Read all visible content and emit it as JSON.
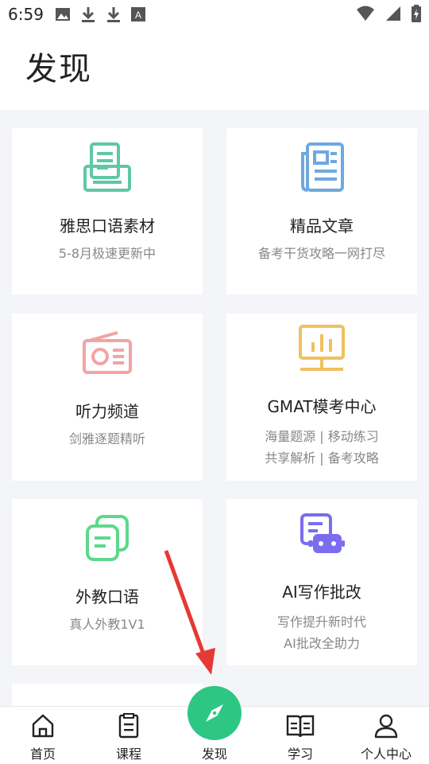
{
  "status_bar": {
    "time": "6:59",
    "left_icons": [
      "image-icon",
      "download-icon",
      "download-icon",
      "font-icon"
    ],
    "right_icons": [
      "wifi-icon",
      "signal-icon",
      "battery-charging-icon"
    ]
  },
  "header": {
    "title": "发现"
  },
  "cards": [
    {
      "title": "雅思口语素材",
      "subtitle_lines": [
        "5-8月极速更新中"
      ],
      "icon": "document-tray-icon",
      "color": "#5ec8a3"
    },
    {
      "title": "精品文章",
      "subtitle_lines": [
        "备考干货攻略一网打尽"
      ],
      "icon": "newspaper-icon",
      "color": "#6fa8e0"
    },
    {
      "title": "听力频道",
      "subtitle_lines": [
        "剑雅逐题精听"
      ],
      "icon": "radio-icon",
      "color": "#f2a4a4"
    },
    {
      "title": "GMAT模考中心",
      "subtitle_lines": [
        "海量题源 | 移动练习",
        "共享解析 | 备考攻略"
      ],
      "icon": "presentation-chart-icon",
      "color": "#f0c060"
    },
    {
      "title": "外教口语",
      "subtitle_lines": [
        "真人外教1V1"
      ],
      "icon": "chat-bubbles-icon",
      "color": "#5ed88a"
    },
    {
      "title": "AI写作批改",
      "subtitle_lines": [
        "写作提升新时代",
        "AI批改全助力"
      ],
      "icon": "robot-icon",
      "color": "#7b6cf0"
    }
  ],
  "tabbar": {
    "tabs": [
      {
        "label": "首页",
        "icon": "home-icon"
      },
      {
        "label": "课程",
        "icon": "notebook-icon"
      },
      {
        "label": "发现",
        "icon": "compass-icon",
        "active": true
      },
      {
        "label": "学习",
        "icon": "open-book-icon"
      },
      {
        "label": "个人中心",
        "icon": "user-icon"
      }
    ],
    "accent": "#2ec683"
  },
  "annotation": {
    "color": "#e53935"
  }
}
